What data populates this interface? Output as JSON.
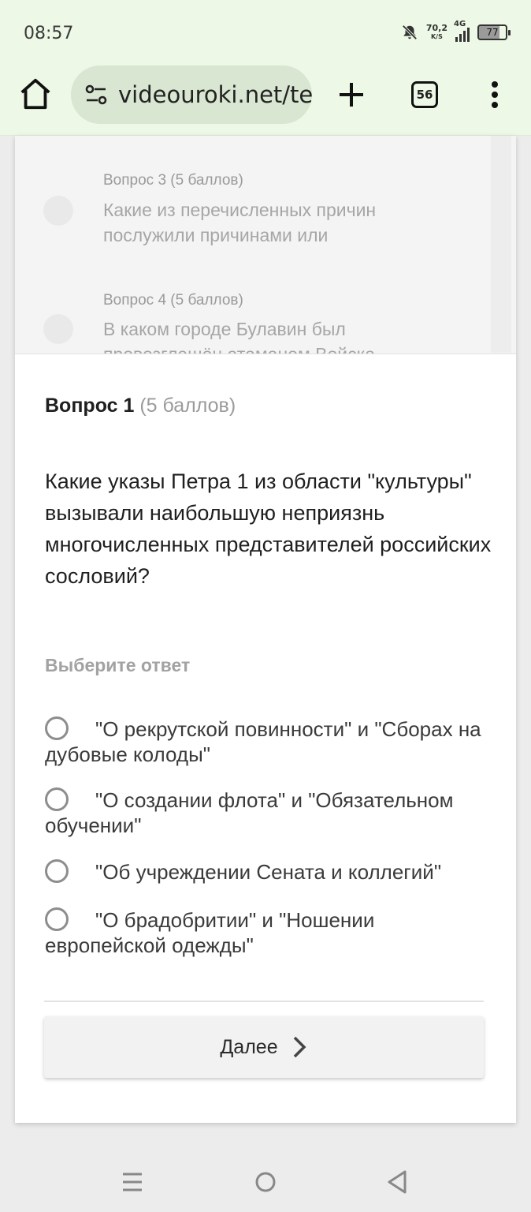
{
  "status_bar": {
    "time": "08:57",
    "net_speed_value": "70,2",
    "net_speed_unit": "K/S",
    "network": "4G",
    "battery": "77"
  },
  "browser": {
    "url": "videouroki.net/tes",
    "tab_count": "56"
  },
  "question_list": [
    {
      "label": "Вопрос 3 (5 баллов)",
      "text": "Какие из перечисленных причин послужили причинами или"
    },
    {
      "label": "Вопрос 4 (5 баллов)",
      "text": "В каком городе Булавин был провозглашён атаманом Войска"
    }
  ],
  "question": {
    "number": "Вопрос 1",
    "points": "(5 баллов)",
    "text": "Какие указы Петра 1 из области \"культуры\" вызывали наибольшую неприязнь многочисленных представителей российских сословий?",
    "prompt": "Выберите ответ",
    "options": [
      "\"О рекрутской повинности\" и \"Сборах на дубовые колоды\"",
      "\"О создании флота\" и \"Обязательном обучении\"",
      "\"Об учреждении Сената и коллегий\"",
      "\"О брадобритии\" и \"Ношении европейской одежды\""
    ]
  },
  "next_button_label": "Далее",
  "icons": {
    "home": "home-icon",
    "tune": "tune-icon",
    "new_tab": "plus-icon",
    "menu": "more-vert-icon",
    "mute": "bell-off-icon",
    "signal": "signal-icon",
    "next": "chevron-right-icon"
  },
  "colors": {
    "toolbar_bg": "#edf8e6",
    "url_pill_bg": "#d9e6d1",
    "page_bg": "#ffffff"
  }
}
